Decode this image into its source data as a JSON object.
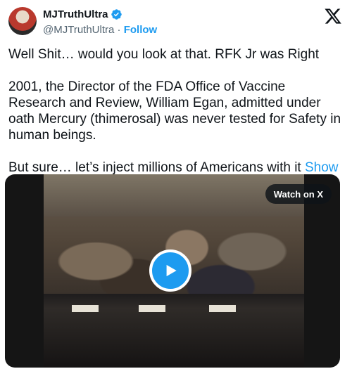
{
  "author": {
    "display_name": "MJTruthUltra",
    "handle": "@MJTruthUltra",
    "separator": "·",
    "follow_label": "Follow",
    "verified": true
  },
  "tweet": {
    "paragraphs": [
      "Well Shit… would you look at that. RFK Jr was Right",
      "2001, the Director of the FDA Office of Vaccine Research and Review, William Egan, admitted under oath Mercury (thimerosal) was never tested for Safety in human beings.",
      "But sure… let’s inject millions of Americans with it"
    ],
    "show_more_label": "Show more"
  },
  "media": {
    "watch_label": "Watch on X"
  },
  "colors": {
    "accent": "#1d9bf0",
    "text": "#0f1419",
    "secondary_text": "#536471"
  },
  "icons": {
    "brand": "x-logo-icon",
    "badge": "verified-badge-icon",
    "play": "play-icon"
  }
}
